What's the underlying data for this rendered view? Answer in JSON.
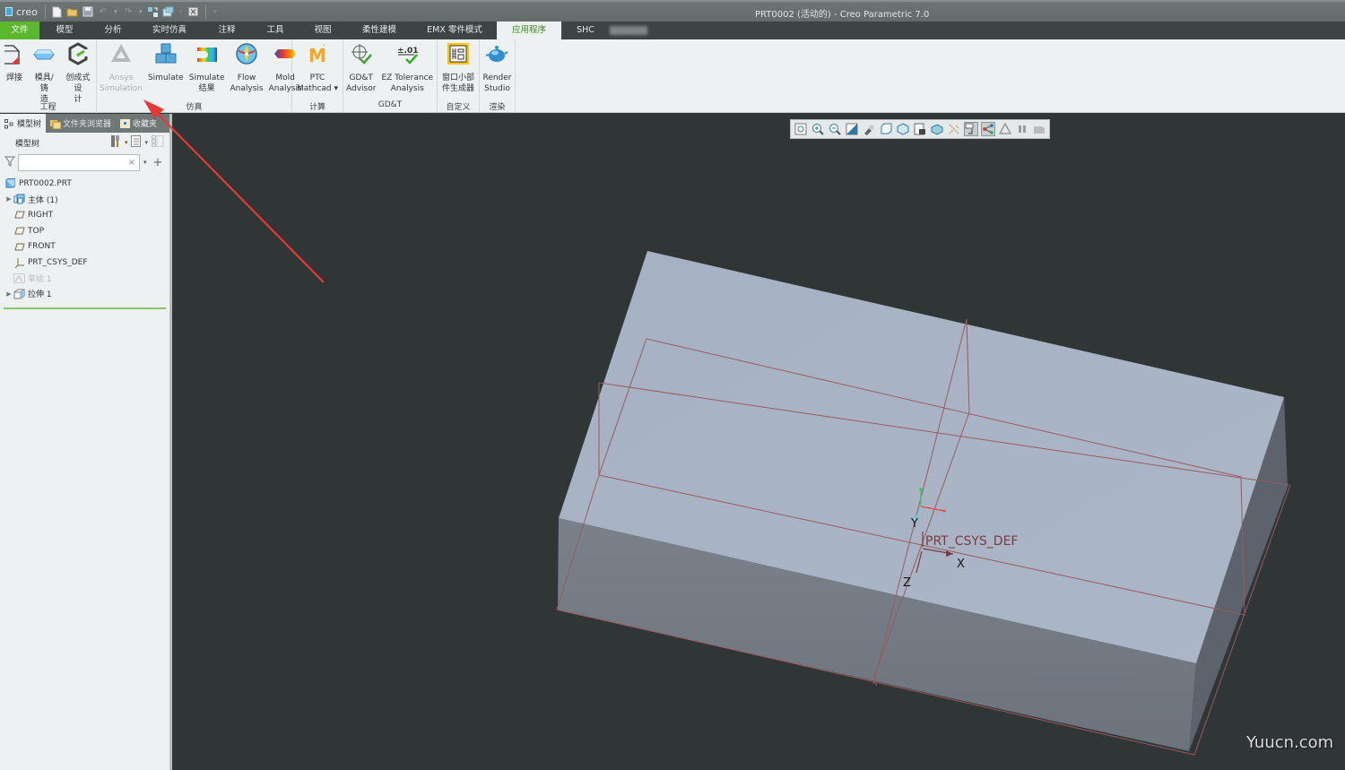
{
  "titlebar": {
    "app_logo": "creo",
    "window_title": "PRT0002 (活动的) - Creo Parametric 7.0",
    "quick_access": [
      {
        "icon": "new-file-icon"
      },
      {
        "icon": "open-folder-icon"
      },
      {
        "icon": "save-icon"
      },
      {
        "icon": "undo-icon"
      },
      {
        "icon": "redo-icon"
      },
      {
        "icon": "regenerate-icon"
      },
      {
        "icon": "windows-icon"
      },
      {
        "icon": "close-window-icon"
      },
      {
        "icon": "customize-dropdown-icon"
      }
    ]
  },
  "ribbon_tabs": [
    {
      "label": "文件",
      "type": "file"
    },
    {
      "label": "模型"
    },
    {
      "label": "分析"
    },
    {
      "label": "实时仿真"
    },
    {
      "label": "注释"
    },
    {
      "label": "工具"
    },
    {
      "label": "视图"
    },
    {
      "label": "柔性建模"
    },
    {
      "label": "EMX 零件模式"
    },
    {
      "label": "应用程序",
      "active": true
    },
    {
      "label": "SHC"
    }
  ],
  "ribbon_groups": [
    {
      "label": "工程",
      "buttons": [
        {
          "label": "焊接",
          "icon": "weld-icon"
        },
        {
          "label": "模具/铸\n造",
          "icon": "mold-cast-icon"
        },
        {
          "label": "创成式设\n计",
          "icon": "generative-design-icon"
        }
      ]
    },
    {
      "label": "仿真",
      "buttons": [
        {
          "label": "Ansys\nSimulation",
          "icon": "ansys-simulation-icon",
          "disabled": true
        },
        {
          "label": "Simulate",
          "icon": "simulate-icon"
        },
        {
          "label": "Simulate\n结果",
          "icon": "simulate-results-icon"
        },
        {
          "label": "Flow\nAnalysis",
          "icon": "flow-analysis-icon"
        },
        {
          "label": "Mold\nAnalysis",
          "icon": "mold-analysis-icon"
        }
      ]
    },
    {
      "label": "计算",
      "buttons": [
        {
          "label": "PTC\nMathcad ▾",
          "icon": "mathcad-icon"
        }
      ]
    },
    {
      "label": "GD&T",
      "buttons": [
        {
          "label": "GD&T\nAdvisor",
          "icon": "gdt-advisor-icon"
        },
        {
          "label": "EZ Tolerance\nAnalysis",
          "icon": "ez-tolerance-icon"
        }
      ]
    },
    {
      "label": "自定义",
      "buttons": [
        {
          "label": "窗口小部\n件生成器",
          "icon": "widget-generator-icon"
        }
      ]
    },
    {
      "label": "渲染",
      "buttons": [
        {
          "label": "Render\nStudio",
          "icon": "render-studio-icon"
        }
      ]
    }
  ],
  "left_panel": {
    "tabs": [
      {
        "label": "模型树",
        "icon": "model-tree-icon",
        "active": true
      },
      {
        "label": "文件夹浏览器",
        "icon": "folder-browser-icon"
      },
      {
        "label": "收藏夹",
        "icon": "favorites-icon"
      }
    ],
    "tree_header": "模型树",
    "filter_placeholder": "",
    "tree": [
      {
        "label": "PRT0002.PRT",
        "icon": "part-icon",
        "expandable": false,
        "indent": 0
      },
      {
        "label": "主体 (1)",
        "icon": "body-icon",
        "expandable": true,
        "indent": 1
      },
      {
        "label": "RIGHT",
        "icon": "datum-plane-icon",
        "indent": 1
      },
      {
        "label": "TOP",
        "icon": "datum-plane-icon",
        "indent": 1
      },
      {
        "label": "FRONT",
        "icon": "datum-plane-icon",
        "indent": 1
      },
      {
        "label": "PRT_CSYS_DEF",
        "icon": "csys-icon",
        "indent": 1
      },
      {
        "label": "草绘 1",
        "icon": "sketch-icon",
        "indent": 1,
        "dim": true
      },
      {
        "label": "拉伸 1",
        "icon": "extrude-icon",
        "expandable": true,
        "indent": 1
      }
    ]
  },
  "view_toolbar": [
    {
      "icon": "refit-icon"
    },
    {
      "icon": "zoom-in-icon"
    },
    {
      "icon": "zoom-out-icon"
    },
    {
      "icon": "repaint-icon"
    },
    {
      "icon": "display-style-icon"
    },
    {
      "icon": "saved-orientations-icon"
    },
    {
      "icon": "view-manager-icon"
    },
    {
      "icon": "perspective-icon"
    },
    {
      "icon": "section-icon"
    },
    {
      "icon": "datum-display-icon"
    },
    {
      "icon": "annotation-display-icon",
      "on": true
    },
    {
      "icon": "spin-center-icon",
      "on": true
    },
    {
      "icon": "simulation-display-icon"
    },
    {
      "icon": "pause-icon"
    },
    {
      "icon": "animation-icon"
    }
  ],
  "model": {
    "csys_label": "PRT_CSYS_DEF",
    "axes": {
      "x": "X",
      "y": "Y",
      "z": "Z"
    }
  },
  "annotation": {
    "arrow_color": "#e53935"
  },
  "watermark": "Yuucn.com",
  "colors": {
    "file_tab": "#5cb82e",
    "active_tab_text": "#3d8a1e",
    "viewport_bg": "#303536",
    "model_top": "#a9b4c5",
    "datum_line": "#9a5a5e"
  }
}
